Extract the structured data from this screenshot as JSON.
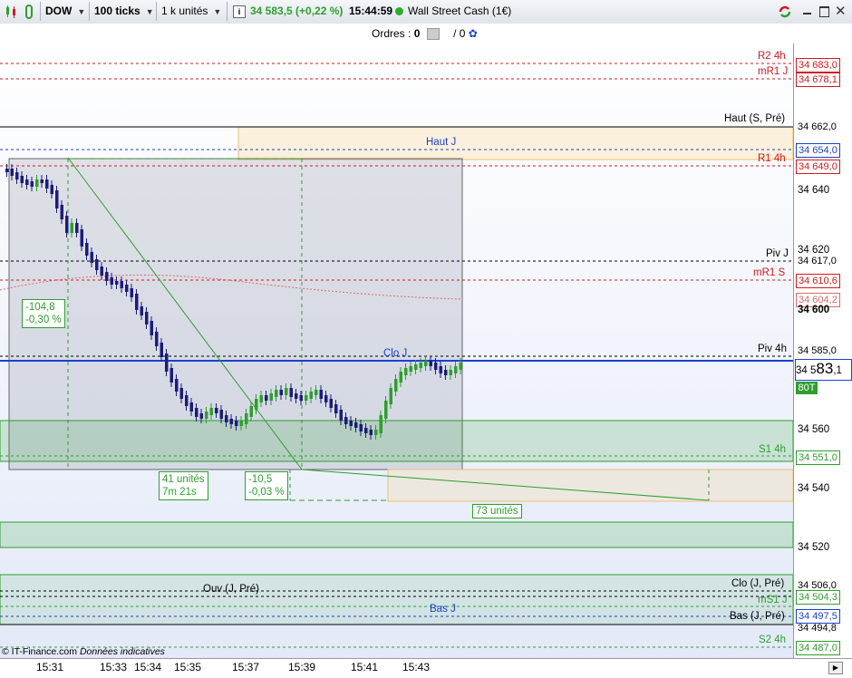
{
  "toolbar": {
    "instrument": "DOW",
    "tick_setting": "100 ticks",
    "quantity": "1 k unités",
    "price_change": "34 583,5 (+0,22 %)",
    "time": "15:44:59",
    "market_name": "Wall Street Cash (1€)"
  },
  "orders": {
    "label": "Ordres :",
    "count": "0",
    "divider": "/",
    "count2": "0"
  },
  "levels": [
    {
      "label": "R2 4h",
      "value": "34 683,0",
      "color": "#d11a1a"
    },
    {
      "label": "mR1 J",
      "value": "34 678,1",
      "color": "#d11a1a"
    },
    {
      "label": "Haut (S, Pré)",
      "value": "34 662,0",
      "color": "#000000"
    },
    {
      "label": "Haut J",
      "value": "34 654,0",
      "color": "#1a3fd1"
    },
    {
      "label": "R1 4h",
      "value": "34 649,0",
      "color": "#d11a1a"
    },
    {
      "label": "Piv J",
      "value": "34 617,0",
      "color": "#000000"
    },
    {
      "label": "mR1 S",
      "value": "34 610,6",
      "color": "#d11a1a"
    },
    {
      "label": "",
      "value": "34 604,2",
      "color": "#d96a6a"
    },
    {
      "label": "Piv 4h",
      "value": "34 585,0",
      "color": "#000000"
    },
    {
      "label": "Clo J",
      "value": "",
      "color": "#1a3fd1"
    },
    {
      "label": "S1 4h",
      "value": "34 551,0",
      "color": "#2e9e2e"
    },
    {
      "label": "Clo (J, Pré)",
      "value": "34 506,0",
      "color": "#000000"
    },
    {
      "label": "Ouv (J, Pré)",
      "value": "",
      "color": "#000000"
    },
    {
      "label": "mS1 J",
      "value": "34 504,3",
      "color": "#2e9e2e"
    },
    {
      "label": "Bas J",
      "value": "34 497,5",
      "color": "#1a3fd1"
    },
    {
      "label": "Bas (J, Pré)",
      "value": "34 494,8",
      "color": "#000000"
    },
    {
      "label": "S2 4h",
      "value": "34 487,0",
      "color": "#2e9e2e"
    }
  ],
  "price_ticks": [
    "34 640",
    "34 620",
    "34 600",
    "34 580",
    "34 560",
    "34 540",
    "34 520"
  ],
  "current_price": {
    "prefix": "34 5",
    "big": "83",
    "suffix": ",1",
    "badge": "80T"
  },
  "time_ticks": [
    "15:31",
    "15:33",
    "15:34",
    "15:35",
    "15:37",
    "15:39",
    "15:41",
    "15:43"
  ],
  "annotations": {
    "box1_line1": "-104,8",
    "box1_line2": "-0,30 %",
    "box2_line1": "41 unités",
    "box2_line2": "7m 21s",
    "box3_line1": "-10,5",
    "box3_line2": "-0,03 %",
    "box4": "73 unités"
  },
  "footer": {
    "source": "© IT-Finance.com",
    "note": "Données indicatives"
  },
  "colors": {
    "bull": "#2e9e2e",
    "bear": "#1c1c7c",
    "resistance": "#d11a1a",
    "support": "#2e9e2e",
    "pivot": "#000000",
    "day": "#1a3fd1"
  }
}
